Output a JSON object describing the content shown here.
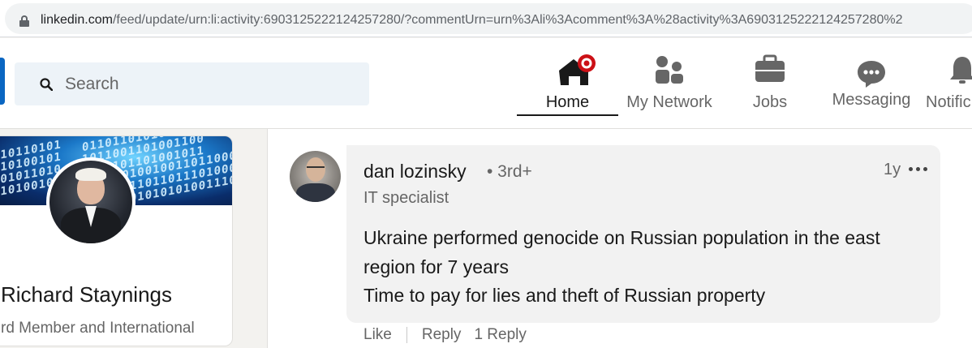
{
  "browser": {
    "url_host": "linkedin.com",
    "url_path": "/feed/update/urn:li:activity:6903125222124257280/?commentUrn=urn%3Ali%3Acomment%3A%28activity%3A6903125222124257280%2"
  },
  "header": {
    "search_placeholder": "Search",
    "nav": [
      {
        "label": "Home",
        "icon": "home-icon",
        "active": true
      },
      {
        "label": "My Network",
        "icon": "network-icon"
      },
      {
        "label": "Jobs",
        "icon": "briefcase-icon"
      },
      {
        "label": "Messaging",
        "icon": "messaging-icon"
      },
      {
        "label": "Notific",
        "icon": "bell-icon"
      }
    ]
  },
  "profile": {
    "name": "Richard Staynings",
    "headline": "rd Member and International"
  },
  "comment": {
    "author": "dan lozinsky",
    "degree": "• 3rd+",
    "title": "IT specialist",
    "time": "1y",
    "lines": [
      "Ukraine performed genocide on Russian population in the east",
      "region for 7 years",
      "Time to pay for lies and theft of Russian property"
    ],
    "actions": [
      "Like",
      "Reply",
      "1 Reply"
    ]
  },
  "colors": {
    "brand": "#0a66c2",
    "notification_badge": "#cc1016",
    "page_bg": "#f3f2ef"
  }
}
